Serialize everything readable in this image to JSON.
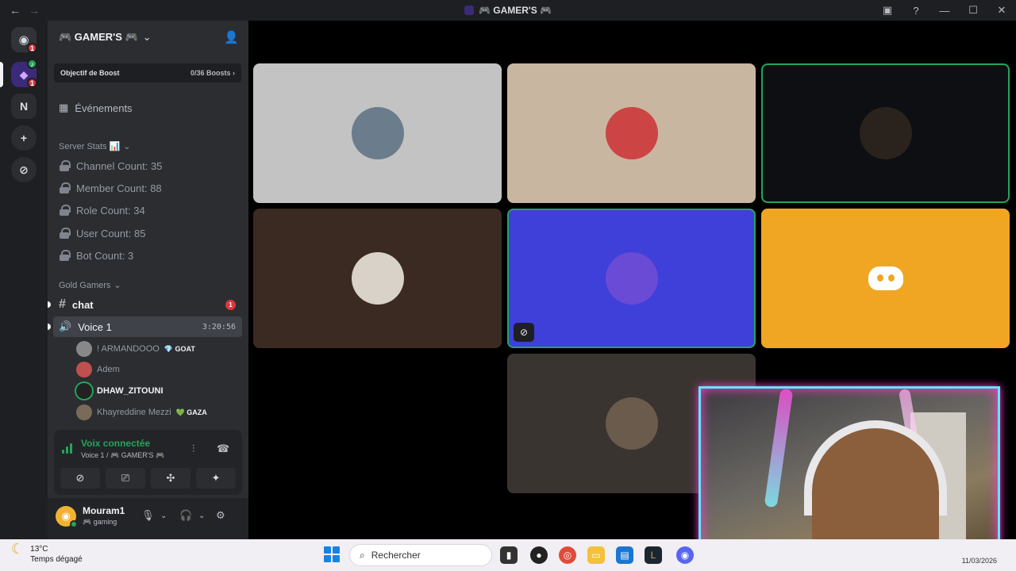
{
  "titlebar": {
    "title": "🎮 GAMER'S 🎮",
    "back": "←",
    "forward": "→"
  },
  "guilds": {
    "home_badge": "1",
    "server_badge": "1",
    "n_label": "N"
  },
  "server": {
    "name": "🎮 GAMER'S 🎮",
    "boost_label": "Objectif de Boost",
    "boost_value": "0/36 Boosts",
    "events_label": "Événements",
    "stats_category": "Server Stats 📊",
    "stats": [
      "Channel Count: 35",
      "Member Count: 88",
      "Role Count: 34",
      "User Count: 85",
      "Bot Count: 3"
    ],
    "gold_category": "Gold Gamers",
    "chat_label": "chat",
    "chat_badge": "1",
    "voice_label": "Voice 1",
    "voice_timer": "3:20:56",
    "voice_users": [
      {
        "name": "! ARMANDOOO",
        "tag": "💎 GOAT"
      },
      {
        "name": "Adem",
        "tag": ""
      },
      {
        "name": "DHAW_ZITOUNI",
        "tag": ""
      },
      {
        "name": "Khayreddine Mezzi",
        "tag": "💚 GAZA"
      }
    ]
  },
  "voice_panel": {
    "status": "Voix connectée",
    "channel": "Voice 1 / 🎮 GAMER'S 🎮"
  },
  "user": {
    "name": "Mouram1",
    "activity": "🎮 gaming"
  },
  "taskbar": {
    "temp": "13°C",
    "weather": "Temps dégagé",
    "search_placeholder": "Rechercher",
    "date": "11/03/2026"
  },
  "colors": {
    "accent_green": "#23a55a",
    "blurple": "#3f3fd9",
    "orange": "#f0a623"
  }
}
